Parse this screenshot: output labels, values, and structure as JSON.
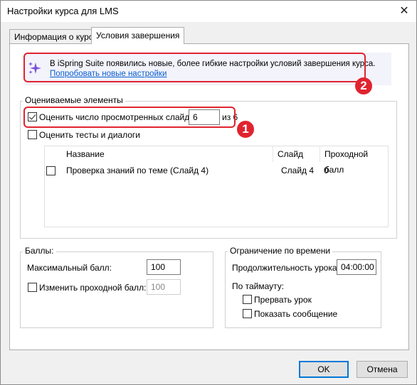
{
  "window": {
    "title": "Настройки курса для LMS",
    "close_glyph": "✕"
  },
  "tabs": [
    {
      "label": "Информация о курсе"
    },
    {
      "label": "Условия завершения"
    }
  ],
  "banner": {
    "text": "В iSpring Suite появились новые, более гибкие настройки условий завершения курса.",
    "link": "Попробовать новые настройки",
    "icon": "sparkle-icon",
    "accent": "#7b4fd6"
  },
  "annotations": {
    "badge1": "1",
    "badge2": "2",
    "color": "#e0242f"
  },
  "graded": {
    "legend": "Оцениваемые элементы",
    "slides_label": "Оценить число просмотренных слайдов:",
    "slides_value": "6",
    "slides_total": "из 6",
    "quizzes_label": "Оценить тесты и диалоги",
    "table": {
      "headers": {
        "name": "Название",
        "slide": "Слайд",
        "pass": "Проходной балл"
      },
      "rows": [
        {
          "name": "Проверка знаний по теме (Слайд 4)",
          "slide": "Слайд 4",
          "pass": "0"
        }
      ]
    }
  },
  "score": {
    "legend": "Баллы:",
    "max_label": "Максимальный балл:",
    "max_value": "100",
    "pass_label": "Изменить проходной балл:",
    "pass_value": "100"
  },
  "time": {
    "legend": "Ограничение по времени",
    "duration_label": "Продолжительность урока:",
    "duration_value": "04:00:00",
    "timeout_label": "По таймауту:",
    "interrupt_label": "Прервать урок",
    "message_label": "Показать сообщение"
  },
  "buttons": {
    "ok": "OK",
    "cancel": "Отмена"
  }
}
